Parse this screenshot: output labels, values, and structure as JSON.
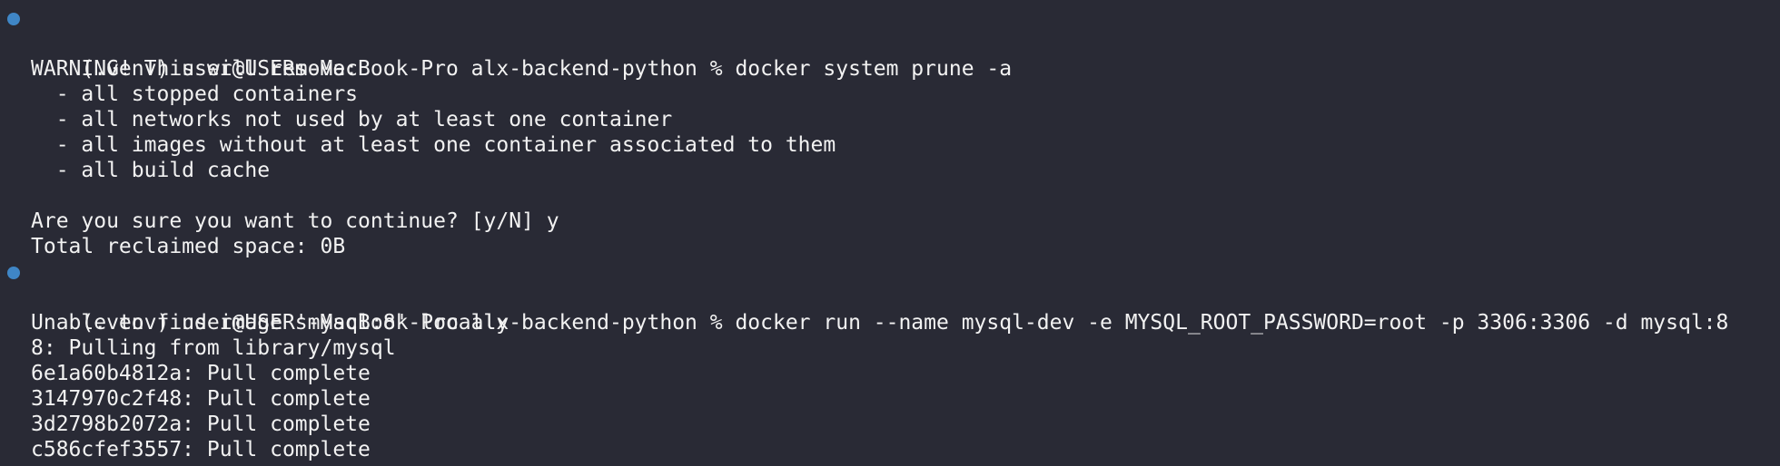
{
  "terminal": {
    "prompt_marker_color": "#3f86c6",
    "blocks": [
      {
        "prompt": "(.venv) user@USERs-MacBook-Pro alx-backend-python % docker system prune -a",
        "output": [
          "",
          "WARNING! This will remove:",
          "  - all stopped containers",
          "  - all networks not used by at least one container",
          "  - all images without at least one container associated to them",
          "  - all build cache",
          "",
          "Are you sure you want to continue? [y/N] y",
          "Total reclaimed space: 0B"
        ]
      },
      {
        "prompt": "(.venv) user@USERs-MacBook-Pro alx-backend-python % docker run --name mysql-dev -e MYSQL_ROOT_PASSWORD=root -p 3306:3306 -d mysql:8",
        "output": [
          "",
          "Unable to find image 'mysql:8' locally",
          "8: Pulling from library/mysql",
          "6e1a60b4812a: Pull complete",
          "3147970c2f48: Pull complete",
          "3d2798b2072a: Pull complete",
          "c586cfef3557: Pull complete"
        ]
      }
    ]
  }
}
